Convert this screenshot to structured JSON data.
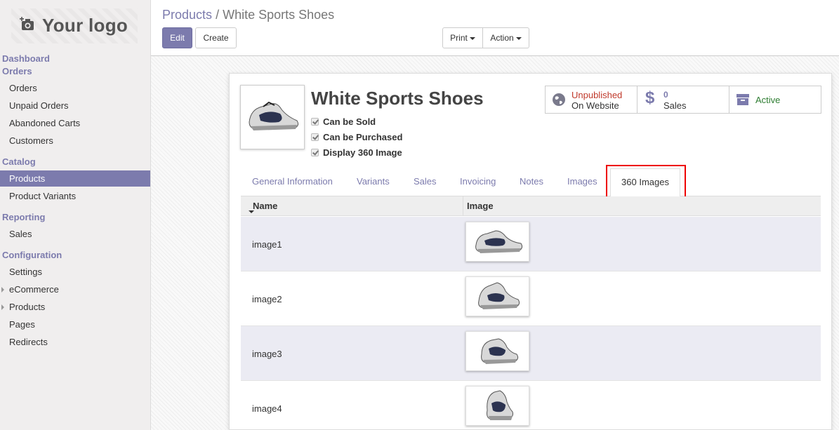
{
  "brand": {
    "logo_text": "Your logo"
  },
  "sidebar": {
    "sections": [
      {
        "title": "Dashboard"
      },
      {
        "title": "Orders",
        "items": [
          "Orders",
          "Unpaid Orders",
          "Abandoned Carts",
          "Customers"
        ]
      },
      {
        "title": "Catalog",
        "items": [
          "Products",
          "Product Variants"
        ],
        "active": "Products"
      },
      {
        "title": "Reporting",
        "items": [
          "Sales"
        ]
      },
      {
        "title": "Configuration",
        "items": [
          "Settings",
          "eCommerce",
          "Products",
          "Pages",
          "Redirects"
        ]
      }
    ]
  },
  "breadcrumb": {
    "parent": "Products",
    "separator": "/",
    "current": "White Sports Shoes"
  },
  "toolbar": {
    "edit_label": "Edit",
    "create_label": "Create",
    "print_label": "Print",
    "action_label": "Action"
  },
  "product": {
    "name": "White Sports Shoes",
    "checkboxes": [
      "Can be Sold",
      "Can be Purchased",
      "Display 360 Image"
    ]
  },
  "stat_buttons": {
    "website": {
      "line1": "Unpublished",
      "line2": "On Website"
    },
    "sales": {
      "count": "0",
      "label": "Sales"
    },
    "active": {
      "label": "Active"
    }
  },
  "tabs": [
    "General Information",
    "Variants",
    "Sales",
    "Invoicing",
    "Notes",
    "Images",
    "360 Images"
  ],
  "active_tab": "360 Images",
  "table": {
    "columns": [
      "Name",
      "Image"
    ],
    "rows": [
      {
        "name": "image1"
      },
      {
        "name": "image2"
      },
      {
        "name": "image3"
      },
      {
        "name": "image4"
      }
    ]
  },
  "colors": {
    "accent": "#7c7bad",
    "unpublished": "#c0392b",
    "active": "#2e7d32",
    "highlight": "#e00000"
  }
}
